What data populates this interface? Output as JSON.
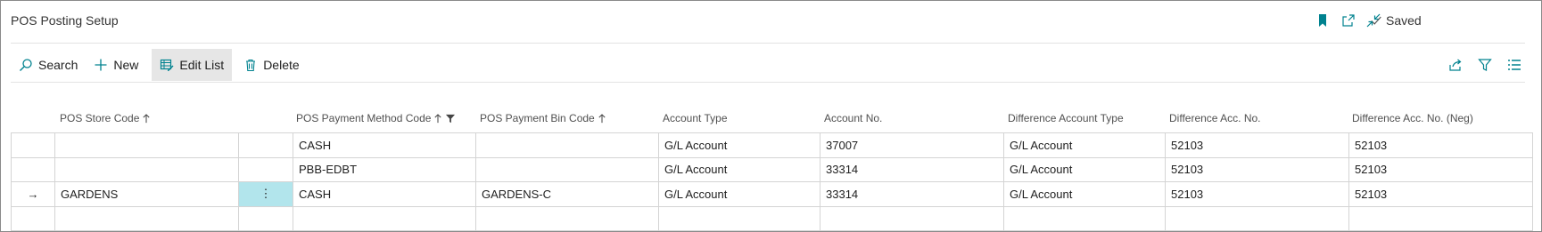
{
  "page": {
    "title": "POS Posting Setup",
    "saved_label": "Saved"
  },
  "actions": {
    "search": "Search",
    "new": "New",
    "edit_list": "Edit List",
    "delete": "Delete"
  },
  "columns": {
    "pos_store_code": "POS Store Code",
    "pos_payment_method_code": "POS Payment Method Code",
    "pos_payment_bin_code": "POS Payment Bin Code",
    "account_type": "Account Type",
    "account_no": "Account No.",
    "difference_account_type": "Difference Account Type",
    "difference_acc_no": "Difference Acc. No.",
    "difference_acc_no_neg": "Difference Acc. No. (Neg)"
  },
  "rows": [
    {
      "indicator": "",
      "store": "",
      "method": "CASH",
      "bin": "",
      "acct_type": "G/L Account",
      "acct_no": "37007",
      "diff_type": "G/L Account",
      "diff_no": "52103",
      "diff_no_neg": "52103"
    },
    {
      "indicator": "",
      "store": "",
      "method": "PBB-EDBT",
      "bin": "",
      "acct_type": "G/L Account",
      "acct_no": "33314",
      "diff_type": "G/L Account",
      "diff_no": "52103",
      "diff_no_neg": "52103"
    },
    {
      "indicator": "→",
      "store": "GARDENS",
      "menu": "⋮",
      "method": "CASH",
      "bin": "GARDENS-C",
      "acct_type": "G/L Account",
      "acct_no": "33314",
      "diff_type": "G/L Account",
      "diff_no": "52103",
      "diff_no_neg": "52103"
    },
    {
      "indicator": "",
      "store": "",
      "method": "",
      "bin": "",
      "acct_type": "",
      "acct_no": "",
      "diff_type": "",
      "diff_no": "",
      "diff_no_neg": ""
    }
  ],
  "colors": {
    "selected_cell": "#b2e5ec",
    "accent": "#00828f",
    "border": "#d4d4d4"
  }
}
